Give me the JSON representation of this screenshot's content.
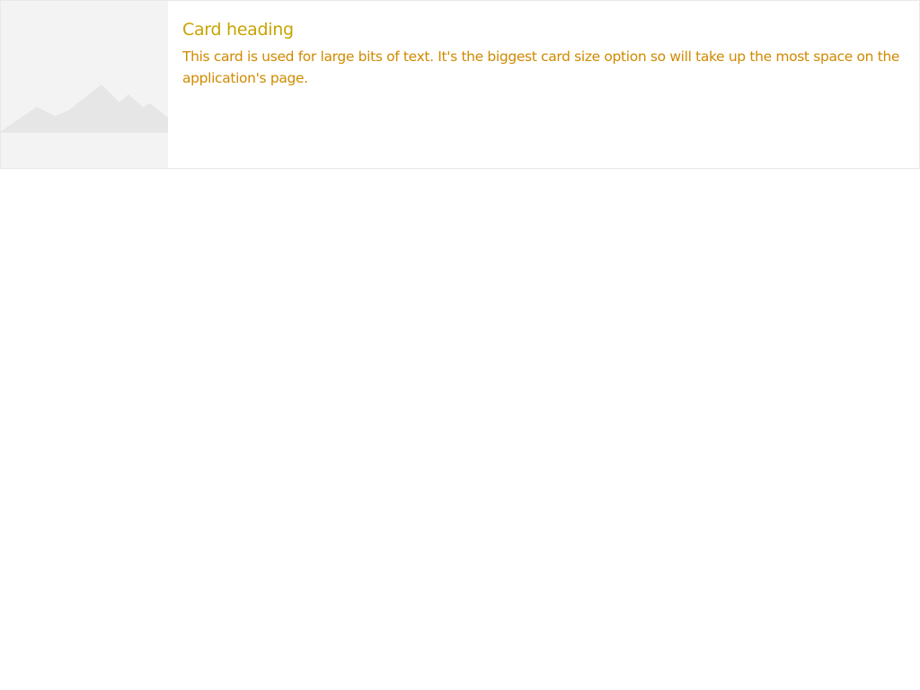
{
  "card": {
    "image_icon": "mountain-placeholder-icon",
    "heading": "Card heading",
    "text": "This card is used for large bits of text. It's the biggest card size option so will take up the most space on the application's page."
  },
  "colors": {
    "heading": "#c8a400",
    "text": "#d08a00",
    "image_background": "#f3f3f3",
    "mountains": "#e6e6e6"
  }
}
